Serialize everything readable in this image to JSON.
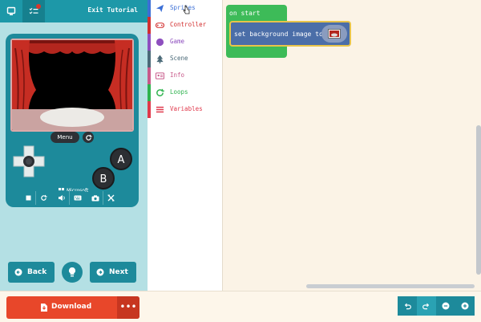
{
  "topbar": {
    "exit_label": "Exit Tutorial"
  },
  "simulator": {
    "menu_label": "Menu",
    "brand_label": "Microsoft"
  },
  "nav": {
    "back_label": "Back",
    "next_label": "Next"
  },
  "toolbox": {
    "categories": [
      {
        "label": "Sprites",
        "color": "#3b6fd6",
        "icon": "paper-plane-icon"
      },
      {
        "label": "Controller",
        "color": "#d32f2f",
        "icon": "gamepad-icon"
      },
      {
        "label": "Game",
        "color": "#8e4fbf",
        "icon": "circle-icon"
      },
      {
        "label": "Scene",
        "color": "#4b6a78",
        "icon": "tree-icon"
      },
      {
        "label": "Info",
        "color": "#c85a8a",
        "icon": "id-card-icon"
      },
      {
        "label": "Loops",
        "color": "#2eb34e",
        "icon": "refresh-icon"
      },
      {
        "label": "Variables",
        "color": "#e0384b",
        "icon": "list-icon"
      }
    ]
  },
  "workspace": {
    "on_start_label": "on start",
    "set_bg_label": "set background image to"
  },
  "bottom": {
    "download_label": "Download",
    "more_label": "•••"
  },
  "colors": {
    "teal": "#1d8a9b",
    "download": "#e8472a",
    "event_green": "#3dbb58",
    "scene_block": "#4b6ea8"
  }
}
